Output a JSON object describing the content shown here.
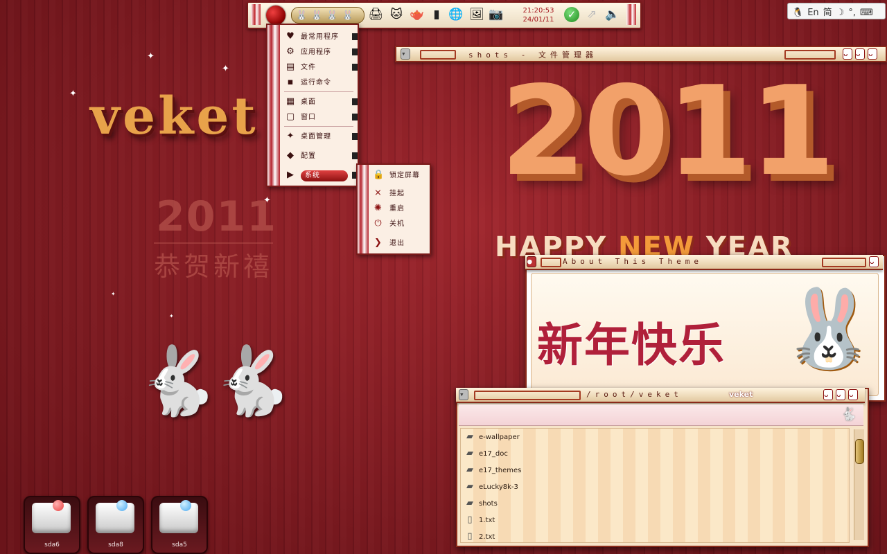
{
  "panel": {
    "clock_time": "21:20:53",
    "clock_date": "24/01/11",
    "pager_icons": [
      "🐰",
      "🐰",
      "🐰",
      "🐰"
    ],
    "launchers": [
      {
        "name": "app-launcher-1",
        "glyph": "🖨"
      },
      {
        "name": "app-launcher-2",
        "glyph": "🐱"
      },
      {
        "name": "app-launcher-3",
        "glyph": "🫖"
      },
      {
        "name": "terminal",
        "glyph": "▮"
      },
      {
        "name": "browser",
        "glyph": "🌐"
      },
      {
        "name": "image-viewer",
        "glyph": "🖼"
      },
      {
        "name": "camera",
        "glyph": "📷"
      }
    ]
  },
  "ime": {
    "lang": "En",
    "mode": "简",
    "punct": "°,"
  },
  "wallpaper": {
    "brand": "veket",
    "year_small": "2011",
    "greeting_small": "恭贺新禧",
    "year_big": "2011",
    "happy": "HAPPY",
    "new": "NEW",
    "year_word": "YEAR"
  },
  "start_menu": {
    "items": [
      {
        "label": "最常用程序",
        "icon": "♥",
        "submenu": true
      },
      {
        "label": "应用程序",
        "icon": "⚙",
        "submenu": true
      },
      {
        "label": "文件",
        "icon": "▤",
        "submenu": true
      },
      {
        "label": "运行命令",
        "icon": "▪",
        "submenu": false
      },
      {
        "label": "桌面",
        "icon": "▦",
        "submenu": true
      },
      {
        "label": "窗口",
        "icon": "▢",
        "submenu": true
      },
      {
        "label": "桌面管理",
        "icon": "✦",
        "submenu": true
      },
      {
        "label": "配置",
        "icon": "◆",
        "submenu": true
      },
      {
        "label": "系统",
        "icon": "▶",
        "submenu": true
      }
    ],
    "system_submenu": [
      {
        "label": "锁定屏幕",
        "icon": "🔒"
      },
      {
        "label": "挂起",
        "icon": "⨯"
      },
      {
        "label": "重启",
        "icon": "✺"
      },
      {
        "label": "关机",
        "icon": "⏻"
      },
      {
        "label": "退出",
        "icon": "❯"
      }
    ]
  },
  "windows": {
    "shots_title": "shots - 文件管理器",
    "about_title": "About This Theme",
    "about_greeting": "新年快乐",
    "files_path": "/root/veket",
    "files_owner": "veket",
    "files": [
      {
        "name": "e-wallpaper",
        "type": "folder"
      },
      {
        "name": "e17_doc",
        "type": "folder"
      },
      {
        "name": "e17_themes",
        "type": "folder"
      },
      {
        "name": "eLucky8k-3",
        "type": "folder"
      },
      {
        "name": "shots",
        "type": "folder"
      },
      {
        "name": "1.txt",
        "type": "file"
      },
      {
        "name": "2.txt",
        "type": "file"
      }
    ]
  },
  "drives": [
    {
      "label": "sda6",
      "led": "#e84040"
    },
    {
      "label": "sda8",
      "led": "#4aa8f0"
    },
    {
      "label": "sda5",
      "led": "#4aa8f0"
    }
  ]
}
